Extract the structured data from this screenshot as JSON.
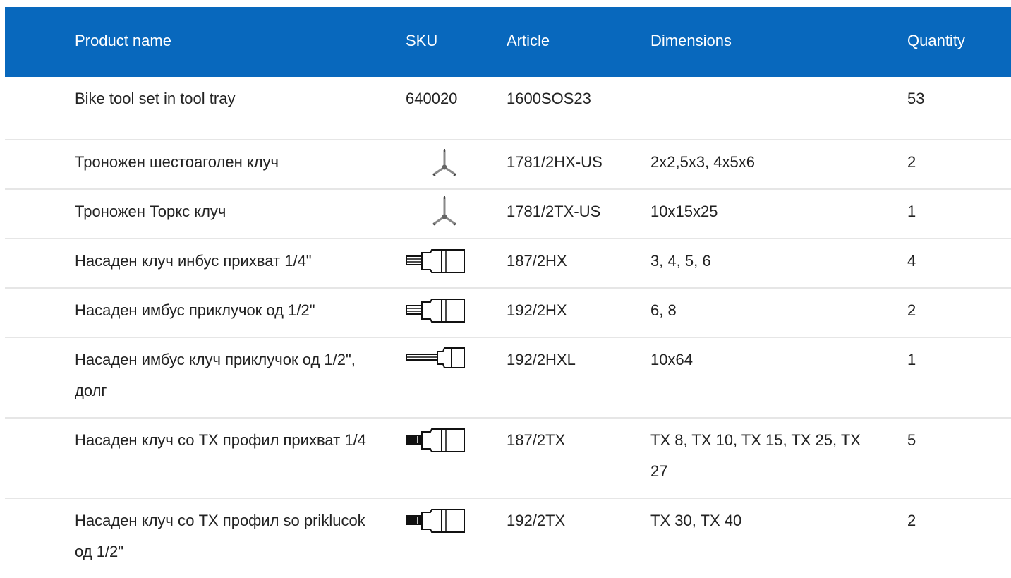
{
  "table": {
    "headers": {
      "product_name": "Product name",
      "sku": "SKU",
      "article": "Article",
      "dimensions": "Dimensions",
      "quantity": "Quantity"
    },
    "rows": [
      {
        "product_name": "Bike tool set in tool tray",
        "sku": "640020",
        "sku_icon": "",
        "article": "1600SOS23",
        "dimensions": "",
        "quantity": "53"
      },
      {
        "product_name": "Троножен шестоаголен клуч",
        "sku": "",
        "sku_icon": "y-hex-wrench-icon",
        "article": "1781/2HX-US",
        "dimensions": "2x2,5x3, 4x5x6",
        "quantity": "2"
      },
      {
        "product_name": "Троножен Торкс клуч",
        "sku": "",
        "sku_icon": "y-torx-wrench-icon",
        "article": "1781/2TX-US",
        "dimensions": "10x15x25",
        "quantity": "1"
      },
      {
        "product_name": "Насаден клуч инбус прихват 1/4\"",
        "sku": "",
        "sku_icon": "hex-socket-bit-icon",
        "article": "187/2HX",
        "dimensions": "3, 4, 5, 6",
        "quantity": "4"
      },
      {
        "product_name": "Насаден имбус приклучок од 1/2\"",
        "sku": "",
        "sku_icon": "hex-socket-bit-icon",
        "article": "192/2HX",
        "dimensions": "6, 8",
        "quantity": "2"
      },
      {
        "product_name": "Насаден имбус клуч приклучок од 1/2\", долг",
        "sku": "",
        "sku_icon": "long-hex-socket-bit-icon",
        "article": "192/2HXL",
        "dimensions": "10x64",
        "quantity": "1"
      },
      {
        "product_name": "Насаден клуч со TX профил прихват 1/4",
        "sku": "",
        "sku_icon": "torx-socket-bit-icon",
        "article": "187/2TX",
        "dimensions": "TX 8, TX 10, TX 15, TX 25, TX 27",
        "quantity": "5"
      },
      {
        "product_name": "Насаден клуч со TX профил so priklucok од 1/2\"",
        "sku": "",
        "sku_icon": "torx-socket-bit-icon",
        "article": "192/2TX",
        "dimensions": "TX 30, TX 40",
        "quantity": "2"
      }
    ]
  },
  "colors": {
    "header_bg": "#0868bd",
    "header_text": "#ffffff",
    "row_divider": "#e6e6e6",
    "body_text": "#222222"
  }
}
